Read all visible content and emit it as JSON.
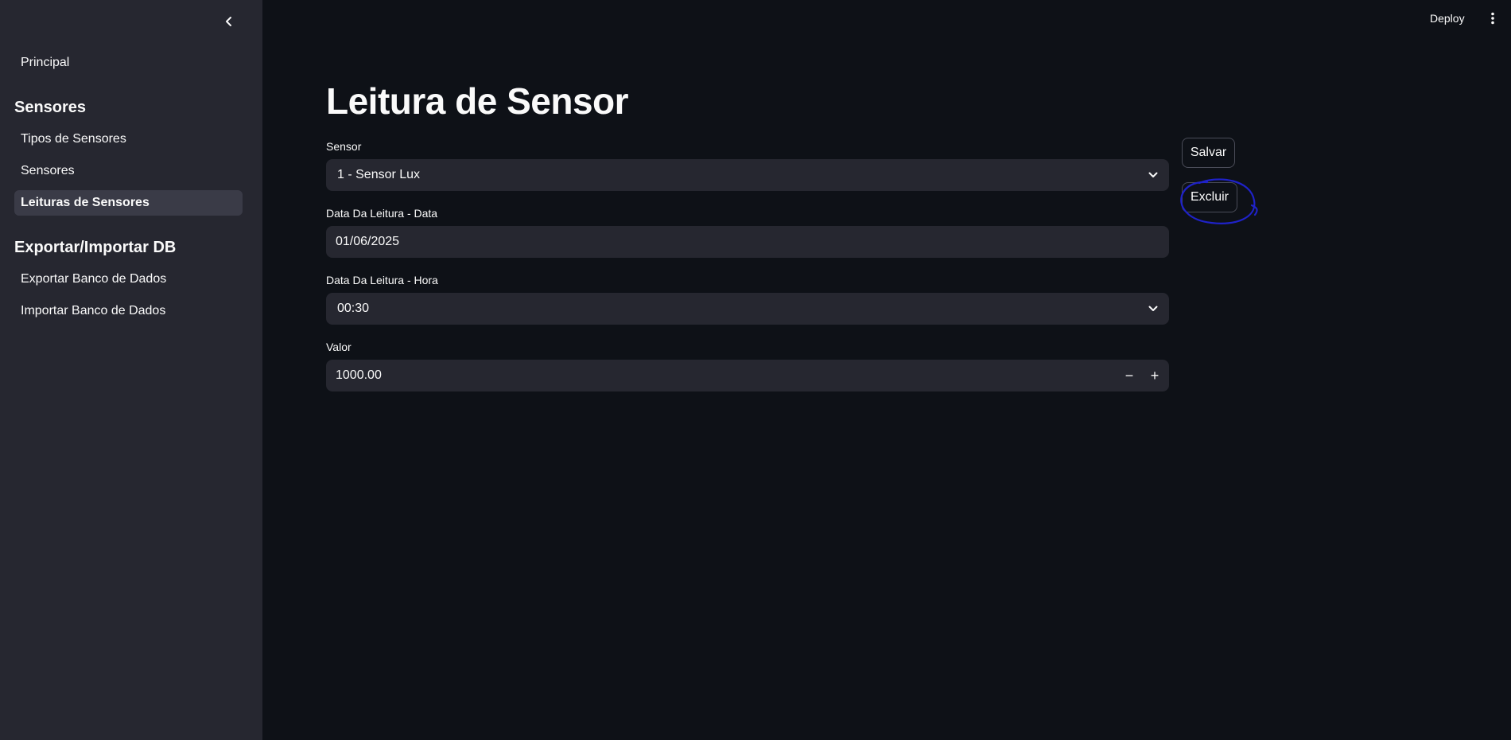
{
  "header": {
    "deploy_label": "Deploy",
    "menu_icon": "vertical-ellipsis-icon"
  },
  "sidebar": {
    "collapse_icon": "chevron-left-icon",
    "items": [
      {
        "label": "Principal"
      },
      {
        "section": "Sensores"
      },
      {
        "label": "Tipos de Sensores"
      },
      {
        "label": "Sensores"
      },
      {
        "label": "Leituras de Sensores",
        "active": true
      },
      {
        "section": "Exportar/Importar DB"
      },
      {
        "label": "Exportar Banco de Dados"
      },
      {
        "label": "Importar Banco de Dados"
      }
    ]
  },
  "main": {
    "title": "Leitura de Sensor",
    "fields": {
      "sensor": {
        "label": "Sensor",
        "value": "1 - Sensor Lux"
      },
      "data": {
        "label": "Data Da Leitura - Data",
        "value": "01/06/2025"
      },
      "hora": {
        "label": "Data Da Leitura - Hora",
        "value": "00:30"
      },
      "valor": {
        "label": "Valor",
        "value": "1000.00",
        "decrement": "−",
        "increment": "+"
      }
    },
    "buttons": {
      "save_label": "Salvar",
      "delete_label": "Excluir"
    }
  },
  "colors": {
    "background": "#0e1117",
    "sidebar": "#262730",
    "input": "#262730",
    "annotation": "#1f22c8"
  }
}
